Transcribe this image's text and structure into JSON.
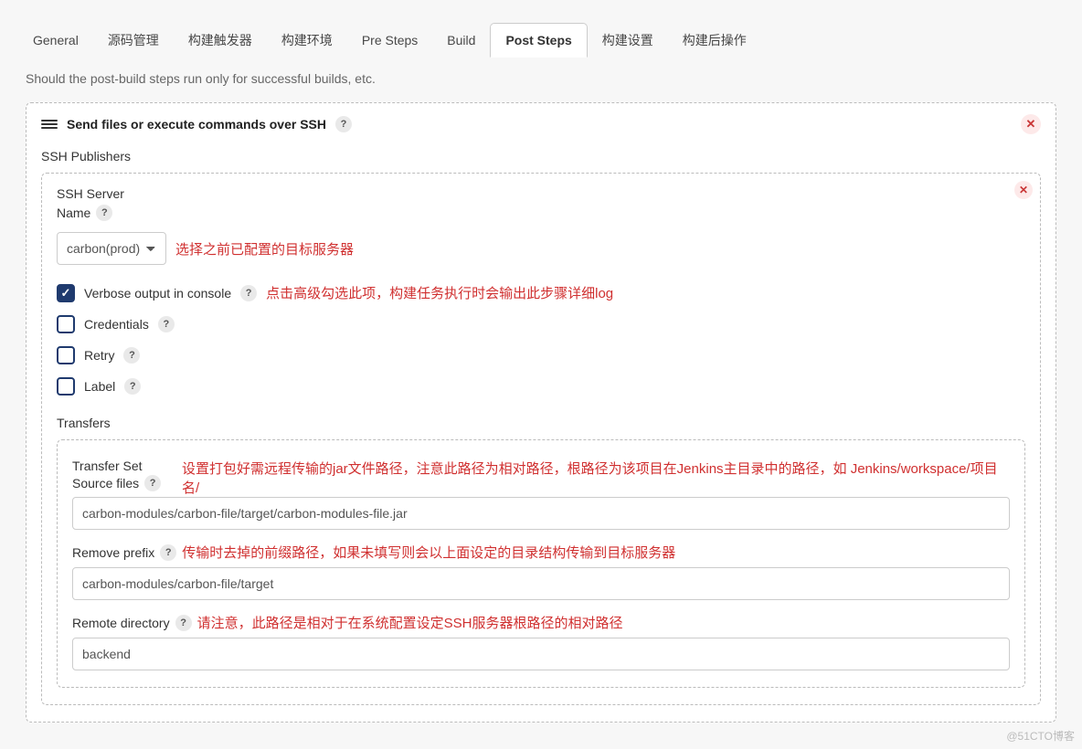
{
  "tabs": [
    "General",
    "源码管理",
    "构建触发器",
    "构建环境",
    "Pre Steps",
    "Build",
    "Post Steps",
    "构建设置",
    "构建后操作"
  ],
  "active_tab": "Post Steps",
  "subtext": "Should the post-build steps run only for successful builds, etc.",
  "step": {
    "title": "Send files or execute commands over SSH",
    "publishers_label": "SSH Publishers",
    "server_label": "SSH Server",
    "name_label": "Name",
    "name_value": "carbon(prod)",
    "name_annotation": "选择之前已配置的目标服务器",
    "options": {
      "verbose": {
        "label": "Verbose output in console",
        "checked": true,
        "annot": "点击高级勾选此项，构建任务执行时会输出此步骤详细log"
      },
      "credentials": {
        "label": "Credentials",
        "checked": false
      },
      "retry": {
        "label": "Retry",
        "checked": false
      },
      "label": {
        "label": "Label",
        "checked": false
      }
    },
    "transfers_label": "Transfers",
    "transfer_set": {
      "set_label": "Transfer Set",
      "source_label": "Source files",
      "source_annot": "设置打包好需远程传输的jar文件路径，注意此路径为相对路径，根路径为该项目在Jenkins主目录中的路径，如 Jenkins/workspace/项目名/",
      "source_value": "carbon-modules/carbon-file/target/carbon-modules-file.jar",
      "remove_prefix_label": "Remove prefix",
      "remove_prefix_annot": "传输时去掉的前缀路径，如果未填写则会以上面设定的目录结构传输到目标服务器",
      "remove_prefix_value": "carbon-modules/carbon-file/target",
      "remote_dir_label": "Remote directory",
      "remote_dir_annot": "请注意，此路径是相对于在系统配置设定SSH服务器根路径的相对路径",
      "remote_dir_value": "backend"
    }
  },
  "watermark": "@51CTO博客"
}
